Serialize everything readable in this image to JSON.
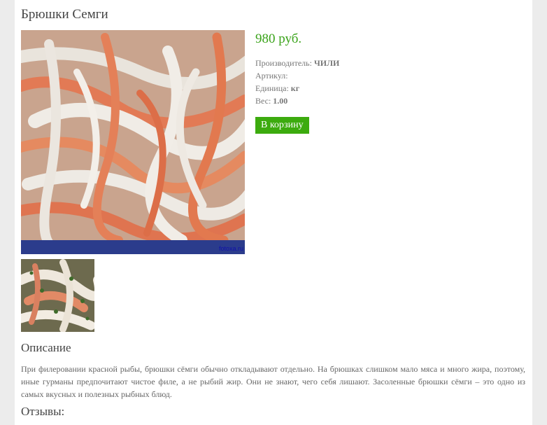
{
  "product": {
    "title": "Брюшки Семги",
    "price": "980 руб.",
    "manufacturer_label": "Производитель:",
    "manufacturer_value": "ЧИЛИ",
    "sku_label": "Артикул:",
    "sku_value": "",
    "unit_label": "Единица:",
    "unit_value": "кг",
    "weight_label": "Вес:",
    "weight_value": "1.00",
    "cart_button": "В корзину",
    "photo_watermark": "fotoxa.ru",
    "photo_subject": "salmon-belly-strips-photo",
    "thumb_subject": "salted-salmon-bellies-with-dill-photo"
  },
  "description": {
    "heading": "Описание",
    "text": "При филеровании красной рыбы, брюшки сёмги обычно откладывают отдельно. На брюшках слишком мало мяса и много жира, поэтому, иные гурманы предпочитают чистое филе, а не рыбий жир. Они не знают, чего себя лишают. Засоленные брюшки сёмги – это одно из самых вкусных и полезных рыбных блюд."
  },
  "reviews": {
    "heading": "Отзывы:"
  },
  "colors": {
    "price": "#3aa31a",
    "button": "#3cab0e",
    "background": "#ececec"
  }
}
